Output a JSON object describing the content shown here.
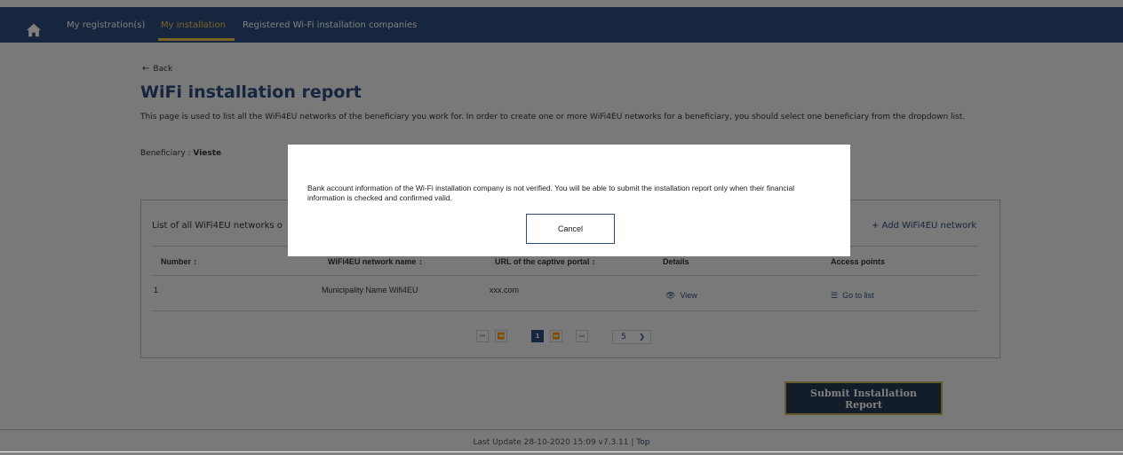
{
  "nav": {
    "items": [
      {
        "label": "My registration(s)",
        "active": false
      },
      {
        "label": "My installation",
        "active": true
      },
      {
        "label": "Registered Wi-Fi installation companies",
        "active": false
      }
    ],
    "accent_color": "#f2c94c",
    "bar_color": "#2d4c7d",
    "home_icon": "home-icon"
  },
  "content": {
    "back_label": "Back",
    "title": "WiFi installation report",
    "intro": "This page is used to list all the WiFi4EU networks of the beneficiary you work for. In order to create one or more WiFi4EU networks for a beneficiary, you should select one beneficiary from the dropdown list.",
    "beneficiary_label": "Beneficiary :",
    "beneficiary_value": "Vieste"
  },
  "panel": {
    "title": "List of all WiFi4EU networks o",
    "add_label": "+ Add WiFi4EU network",
    "columns": [
      "Number ↕",
      "WiFi4EU network name ↕",
      "URL of the captive portal ↕",
      "Details",
      "Access points"
    ],
    "rows": [
      {
        "number": "1",
        "name": "Municipality Name Wifi4EU",
        "url": "xxx.com",
        "details": "View",
        "access": "Go to list"
      }
    ],
    "pager": {
      "first": "⏮",
      "prev": "⏪",
      "current": "1",
      "next": "⏩",
      "last": "⏭",
      "page_size": "5"
    }
  },
  "submit_label_line1": "Submit Installation",
  "submit_label_line2": "Report",
  "footer": {
    "text": "Last Update 28-10-2020 15:09 v7.3.11 |",
    "top_link": "Top"
  },
  "modal": {
    "message": "Bank account information of the Wi-Fi installation company is not verified. You will be able to submit the installation report only when their financial information is checked and confirmed valid.",
    "cancel_label": "Cancel"
  }
}
